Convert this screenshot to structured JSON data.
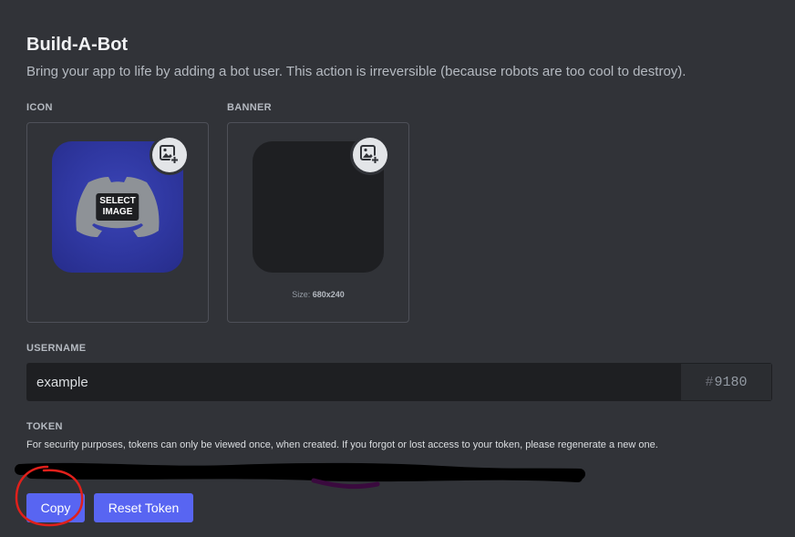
{
  "header": {
    "title": "Build-A-Bot",
    "subtitle": "Bring your app to life by adding a bot user. This action is irreversible (because robots are too cool to destroy)."
  },
  "icon_section": {
    "label": "ICON",
    "select_image_line1": "SELECT",
    "select_image_line2": "IMAGE"
  },
  "banner_section": {
    "label": "BANNER",
    "size_prefix": "Size: ",
    "size_value": "680x240"
  },
  "username": {
    "label": "USERNAME",
    "value": "example",
    "discriminator_hash": "#",
    "discriminator": "9180"
  },
  "token": {
    "label": "TOKEN",
    "description": "For security purposes, tokens can only be viewed once, when created. If you forgot or lost access to your token, please regenerate a new one."
  },
  "buttons": {
    "copy": "Copy",
    "reset_token": "Reset Token"
  },
  "colors": {
    "background": "#313338",
    "accent": "#5865f2",
    "annotation": "#e0201b"
  }
}
